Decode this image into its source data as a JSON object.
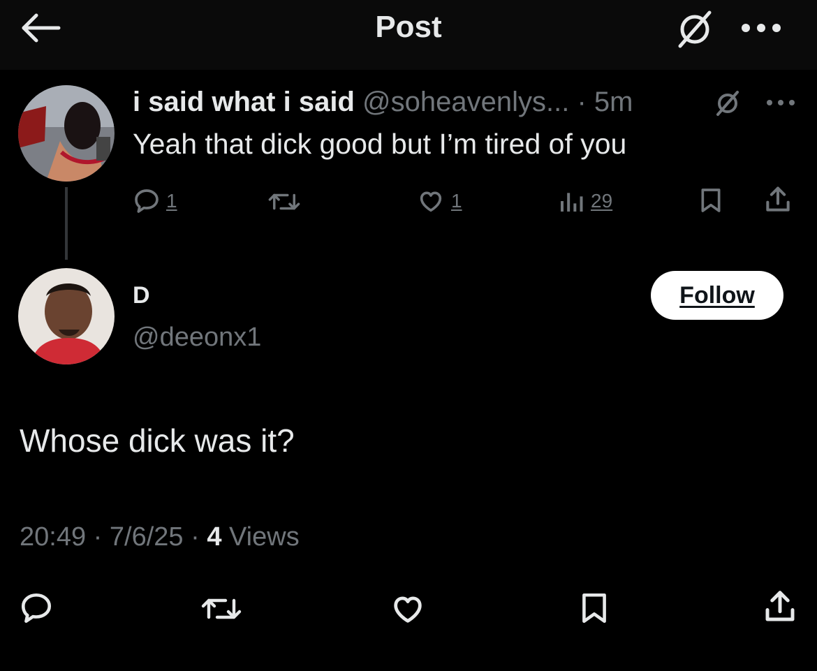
{
  "header": {
    "title": "Post",
    "back_icon": "arrow-left-icon",
    "grok_icon": "grok-icon",
    "more_icon": "more-horizontal-icon"
  },
  "parent_post": {
    "display_name": "i said what i said",
    "handle": "@soheavenlys...",
    "separator": "·",
    "time": "5m",
    "text": "Yeah that dick good but I’m tired of you",
    "actions": {
      "replies": "1",
      "reposts": "",
      "likes": "1",
      "views": "29"
    }
  },
  "reply_post": {
    "display_name": "D",
    "handle": "@deeonx1",
    "follow_label": "Follow",
    "text": "Whose dick was it?",
    "time": "20:49",
    "date": "7/6/25",
    "separator": "·",
    "views_count": "4",
    "views_label": "Views"
  },
  "colors": {
    "background": "#000000",
    "text_primary": "#e7e9ea",
    "text_secondary": "#71767b",
    "follow_button_bg": "#ffffff"
  }
}
